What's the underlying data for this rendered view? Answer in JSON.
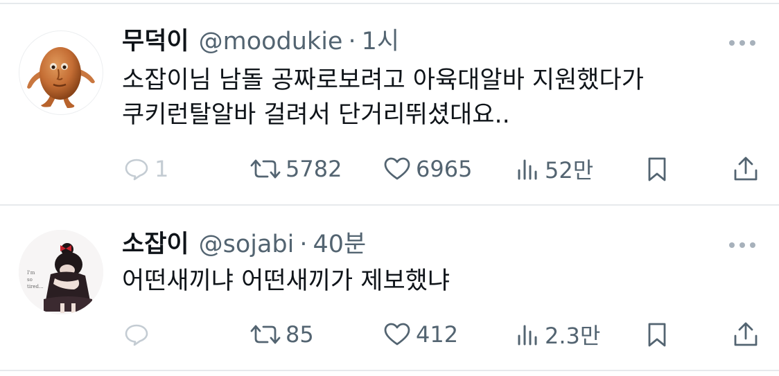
{
  "tweets": [
    {
      "name": "무덕이",
      "handle": "@moodukie",
      "separator": "·",
      "time": "1시",
      "text": "소잡이님 남돌 공짜로보려고 아육대알바 지원했다가 쿠키런탈알바 걸려서 단거리뛰셨대요..",
      "replies": "1",
      "retweets": "5782",
      "likes": "6965",
      "views": "52만",
      "avatar_icon": "orange-creature-avatar"
    },
    {
      "name": "소잡이",
      "handle": "@sojabi",
      "separator": "·",
      "time": "40분",
      "text": "어떤새끼냐  어떤새끼가 제보했냐",
      "replies": "",
      "retweets": "85",
      "likes": "412",
      "views": "2.3만",
      "avatar_icon": "girl-photo-avatar"
    }
  ],
  "icons": {
    "reply": "speech-bubble-icon",
    "retweet": "retweet-arrows-icon",
    "like": "heart-icon",
    "views": "bar-chart-icon",
    "bookmark": "bookmark-icon",
    "share": "share-upload-icon",
    "more": "more-dots-icon"
  },
  "colors": {
    "text_primary": "#0f1419",
    "text_secondary": "#536471",
    "icon_muted": "#c4ccd3",
    "divider": "#e6e9ec"
  }
}
